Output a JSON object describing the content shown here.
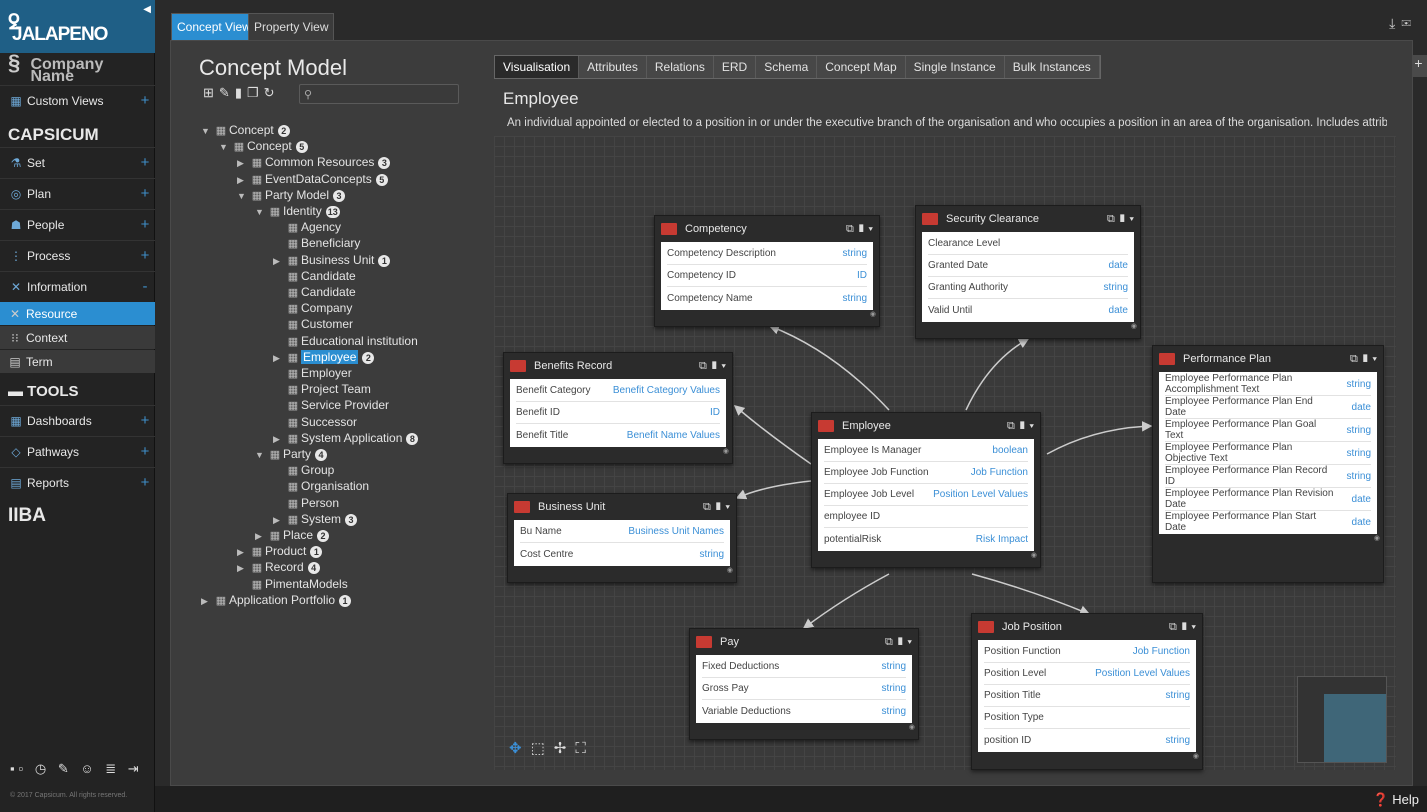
{
  "app": {
    "logo_text": "JALAPENO",
    "company": "Company\nName",
    "brand_capsicum": "CAPSICUM",
    "tools": "TOOLS",
    "iiba": "IIBA",
    "copyright": "© 2017 Capsicum. All rights reserved.",
    "help": "Help"
  },
  "nav": [
    {
      "label": "Custom Views",
      "icon": "grid-icon",
      "plus": "+"
    },
    {
      "label": "Set",
      "icon": "badge-icon",
      "plus": "+"
    },
    {
      "label": "Plan",
      "icon": "target-icon",
      "plus": "+"
    },
    {
      "label": "People",
      "icon": "person-icon",
      "plus": "+"
    },
    {
      "label": "Process",
      "icon": "process-icon",
      "plus": "+"
    },
    {
      "label": "Information",
      "icon": "tools-icon",
      "plus": "-"
    }
  ],
  "subnav": [
    {
      "label": "Resource",
      "active": true
    },
    {
      "label": "Context",
      "active": false
    },
    {
      "label": "Term",
      "active": false
    }
  ],
  "tools_nav": [
    {
      "label": "Dashboards",
      "plus": "+"
    },
    {
      "label": "Pathways",
      "plus": "+"
    },
    {
      "label": "Reports",
      "plus": "+"
    }
  ],
  "view_tabs": [
    "Concept View",
    "Property View"
  ],
  "concept_model": {
    "title": "Concept Model",
    "tree": [
      {
        "label": "Concept",
        "badge": "2",
        "level": 0,
        "tw": "▼"
      },
      {
        "label": "Concept",
        "badge": "5",
        "level": 1,
        "tw": "▼"
      },
      {
        "label": "Common Resources",
        "badge": "3",
        "level": 2,
        "tw": "▶"
      },
      {
        "label": "EventDataConcepts",
        "badge": "5",
        "level": 2,
        "tw": "▶"
      },
      {
        "label": "Party Model",
        "badge": "3",
        "level": 2,
        "tw": "▼"
      },
      {
        "label": "Identity",
        "badge": "13",
        "level": 3,
        "tw": "▼"
      },
      {
        "label": "Agency",
        "badge": "",
        "level": 4,
        "tw": ""
      },
      {
        "label": "Beneficiary",
        "badge": "",
        "level": 4,
        "tw": ""
      },
      {
        "label": "Business Unit",
        "badge": "1",
        "level": 4,
        "tw": "▶"
      },
      {
        "label": "Candidate",
        "badge": "",
        "level": 4,
        "tw": ""
      },
      {
        "label": "Candidate",
        "badge": "",
        "level": 4,
        "tw": ""
      },
      {
        "label": "Company",
        "badge": "",
        "level": 4,
        "tw": ""
      },
      {
        "label": "Customer",
        "badge": "",
        "level": 4,
        "tw": ""
      },
      {
        "label": "Educational institution",
        "badge": "",
        "level": 4,
        "tw": ""
      },
      {
        "label": "Employee",
        "badge": "2",
        "level": 4,
        "tw": "▶",
        "selected": true
      },
      {
        "label": "Employer",
        "badge": "",
        "level": 4,
        "tw": ""
      },
      {
        "label": "Project Team",
        "badge": "",
        "level": 4,
        "tw": ""
      },
      {
        "label": "Service Provider",
        "badge": "",
        "level": 4,
        "tw": ""
      },
      {
        "label": "Successor",
        "badge": "",
        "level": 4,
        "tw": ""
      },
      {
        "label": "System Application",
        "badge": "8",
        "level": 4,
        "tw": "▶"
      },
      {
        "label": "Party",
        "badge": "4",
        "level": 3,
        "tw": "▼"
      },
      {
        "label": "Group",
        "badge": "",
        "level": 4,
        "tw": ""
      },
      {
        "label": "Organisation",
        "badge": "",
        "level": 4,
        "tw": ""
      },
      {
        "label": "Person",
        "badge": "",
        "level": 4,
        "tw": ""
      },
      {
        "label": "System",
        "badge": "3",
        "level": 4,
        "tw": "▶"
      },
      {
        "label": "Place",
        "badge": "2",
        "level": 3,
        "tw": "▶"
      },
      {
        "label": "Product",
        "badge": "1",
        "level": 2,
        "tw": "▶"
      },
      {
        "label": "Record",
        "badge": "4",
        "level": 2,
        "tw": "▶"
      },
      {
        "label": "PimentaModels",
        "badge": "",
        "level": 2,
        "tw": ""
      },
      {
        "label": "Application Portfolio",
        "badge": "1",
        "level": 0,
        "tw": "▶"
      }
    ]
  },
  "vis_tabs": [
    "Visualisation",
    "Attributes",
    "Relations",
    "ERD",
    "Schema",
    "Concept Map",
    "Single Instance",
    "Bulk Instances"
  ],
  "entity": {
    "title": "Employee",
    "description": "An individual appointed or elected to a position in or under the executive branch of the organisation and who occupies a position in an area of the organisation. Includes attributes ..."
  },
  "cards": {
    "competency": {
      "title": "Competency",
      "rows": [
        [
          "Competency Description",
          "string"
        ],
        [
          "Competency ID",
          "ID"
        ],
        [
          "Competency Name",
          "string"
        ]
      ]
    },
    "security": {
      "title": "Security Clearance",
      "rows": [
        [
          "Clearance Level",
          ""
        ],
        [
          "Granted Date",
          "date"
        ],
        [
          "Granting Authority",
          "string"
        ],
        [
          "Valid Until",
          "date"
        ]
      ]
    },
    "benefits": {
      "title": "Benefits Record",
      "rows": [
        [
          "Benefit Category",
          "Benefit Category Values"
        ],
        [
          "Benefit ID",
          "ID"
        ],
        [
          "Benefit Title",
          "Benefit Name Values"
        ]
      ]
    },
    "employee": {
      "title": "Employee",
      "rows": [
        [
          "Employee Is Manager",
          "boolean"
        ],
        [
          "Employee Job Function",
          "Job Function"
        ],
        [
          "Employee Job Level",
          "Position Level Values"
        ],
        [
          "employee ID",
          ""
        ],
        [
          "potentialRisk",
          "Risk Impact"
        ]
      ]
    },
    "performance": {
      "title": "Performance Plan",
      "rows": [
        [
          "Employee Performance Plan Accomplishment Text",
          "string"
        ],
        [
          "Employee Performance Plan End Date",
          "date"
        ],
        [
          "Employee Performance Plan Goal Text",
          "string"
        ],
        [
          "Employee Performance Plan Objective Text",
          "string"
        ],
        [
          "Employee Performance Plan Record ID",
          "string"
        ],
        [
          "Employee Performance Plan Revision Date",
          "date"
        ],
        [
          "Employee Performance Plan Start Date",
          "date"
        ]
      ]
    },
    "businessunit": {
      "title": "Business Unit",
      "rows": [
        [
          "Bu Name",
          "Business Unit Names"
        ],
        [
          "Cost Centre",
          "string"
        ]
      ]
    },
    "pay": {
      "title": "Pay",
      "rows": [
        [
          "Fixed Deductions",
          "string"
        ],
        [
          "Gross Pay",
          "string"
        ],
        [
          "Variable Deductions",
          "string"
        ]
      ]
    },
    "jobposition": {
      "title": "Job Position",
      "rows": [
        [
          "Position Function",
          "Job Function"
        ],
        [
          "Position Level",
          "Position Level Values"
        ],
        [
          "Position Title",
          "string"
        ],
        [
          "Position Type",
          ""
        ],
        [
          "position ID",
          "string"
        ]
      ]
    }
  }
}
